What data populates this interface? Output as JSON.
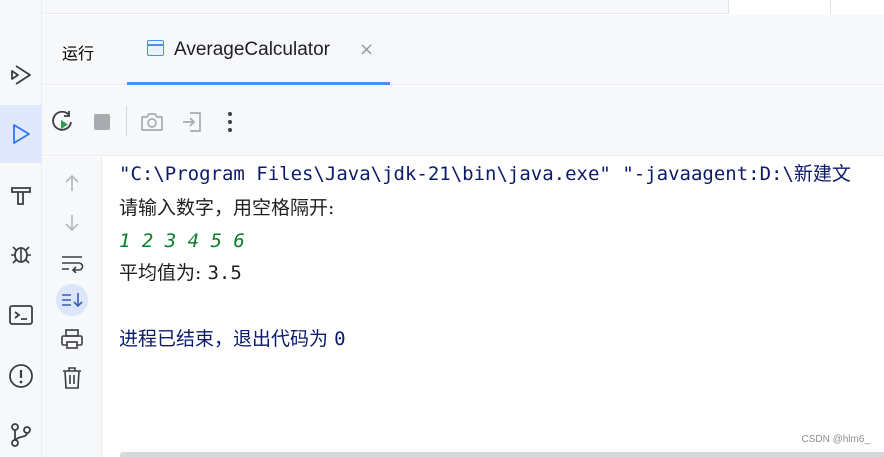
{
  "tool_window": {
    "title": "运行",
    "tab_label": "AverageCalculator",
    "tab_close": "×"
  },
  "console": {
    "command_line": "\"C:\\Program Files\\Java\\jdk-21\\bin\\java.exe\" \"-javaagent:D:\\新建文",
    "prompt": "请输入数字，用空格隔开:",
    "user_input": "1 2 3 4 5 6",
    "result_label": "平均值为:",
    "result_value": "3.5",
    "exit_message": "进程已结束，退出代码为",
    "exit_code": "0"
  },
  "watermark": "CSDN @hlm6_",
  "icons": {
    "activity_bar": [
      "services-icon",
      "run-icon",
      "build-icon",
      "debug-icon",
      "terminal-icon",
      "problems-icon",
      "git-icon"
    ],
    "toolbar": [
      "rerun-icon",
      "stop-icon",
      "screenshot-icon",
      "restore-layout-icon",
      "more-options-icon"
    ],
    "gutter": [
      "scroll-up-icon",
      "scroll-down-icon",
      "soft-wrap-icon",
      "scroll-to-end-icon",
      "print-icon",
      "clear-all-icon"
    ]
  },
  "colors": {
    "accent": "#4d8ef0",
    "command_text": "#0b1a6b",
    "input_text": "#0a7f27",
    "panel_bg": "#f7f8fa",
    "active_bg": "#dfe9fb"
  }
}
